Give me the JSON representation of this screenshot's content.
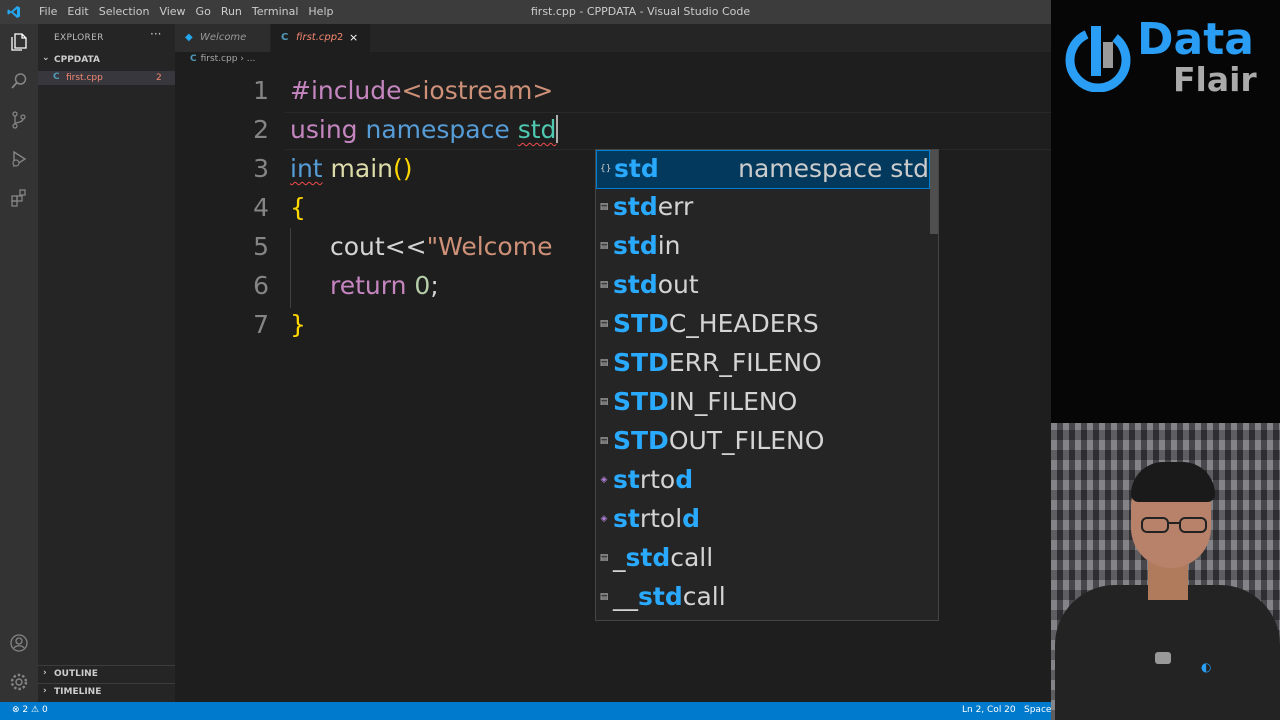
{
  "titlebar": {
    "menu": [
      "File",
      "Edit",
      "Selection",
      "View",
      "Go",
      "Run",
      "Terminal",
      "Help"
    ],
    "title": "first.cpp - CPPDATA - Visual Studio Code"
  },
  "activity_bar": [
    "explorer-icon",
    "search-icon",
    "source-control-icon",
    "run-debug-icon",
    "extensions-icon",
    "account-icon",
    "settings-gear-icon"
  ],
  "sidebar": {
    "title": "EXPLORER",
    "more": "···",
    "folder": "CPPDATA",
    "files": [
      {
        "name": "first.cpp",
        "problems": "2"
      }
    ],
    "sections": [
      "OUTLINE",
      "TIMELINE"
    ]
  },
  "tabs": [
    {
      "label": "Welcome"
    },
    {
      "label": "first.cpp",
      "problems": "2",
      "close": "×"
    }
  ],
  "breadcrumb": {
    "file": "first.cpp",
    "rest": "..."
  },
  "editor": {
    "line_numbers": [
      "1",
      "2",
      "3",
      "4",
      "5",
      "6",
      "7"
    ],
    "lines": {
      "l1": {
        "directive": "#include",
        "header": "<iostream>"
      },
      "l2": {
        "using": "using",
        "namespace": "namespace",
        "typed": "std"
      },
      "l3": {
        "type": "int",
        "fn": "main",
        "parens": "()"
      },
      "l4": {
        "brace": "{"
      },
      "l5": {
        "code": "cout<<",
        "string": "\"Welcome"
      },
      "l6": {
        "kw": "return",
        "num": "0",
        "semi": ";"
      },
      "l7": {
        "brace": "}"
      }
    }
  },
  "suggest": {
    "items": [
      {
        "icon": "namespace-icon",
        "match": "std",
        "rest": "",
        "detail": "namespace std"
      },
      {
        "icon": "variable-icon",
        "match": "std",
        "rest": "err"
      },
      {
        "icon": "variable-icon",
        "match": "std",
        "rest": "in"
      },
      {
        "icon": "variable-icon",
        "match": "std",
        "rest": "out"
      },
      {
        "icon": "variable-icon",
        "match": "STD",
        "rest": "C_HEADERS"
      },
      {
        "icon": "variable-icon",
        "match": "STD",
        "rest": "ERR_FILENO"
      },
      {
        "icon": "variable-icon",
        "match": "STD",
        "rest": "IN_FILENO"
      },
      {
        "icon": "variable-icon",
        "match": "STD",
        "rest": "OUT_FILENO"
      },
      {
        "icon": "method-icon",
        "pre1": "",
        "m1": "st",
        "mid": "rto",
        "m2": "d"
      },
      {
        "icon": "method-icon",
        "pre1": "",
        "m1": "st",
        "mid": "rtol",
        "m2": "d"
      },
      {
        "icon": "variable-icon",
        "pre": "_",
        "match": "std",
        "rest": "call"
      },
      {
        "icon": "variable-icon",
        "pre": "__",
        "match": "std",
        "rest": "call"
      }
    ]
  },
  "statusbar": {
    "errors": "2",
    "warnings": "0",
    "position": "Ln 2, Col 20",
    "spaces": "Spaces"
  },
  "webcam": {
    "logo_data": "Data",
    "logo_flair": "Flair"
  },
  "colors": {
    "accent": "#007acc",
    "highlight": "#2aaaff",
    "selection": "#04395e"
  }
}
